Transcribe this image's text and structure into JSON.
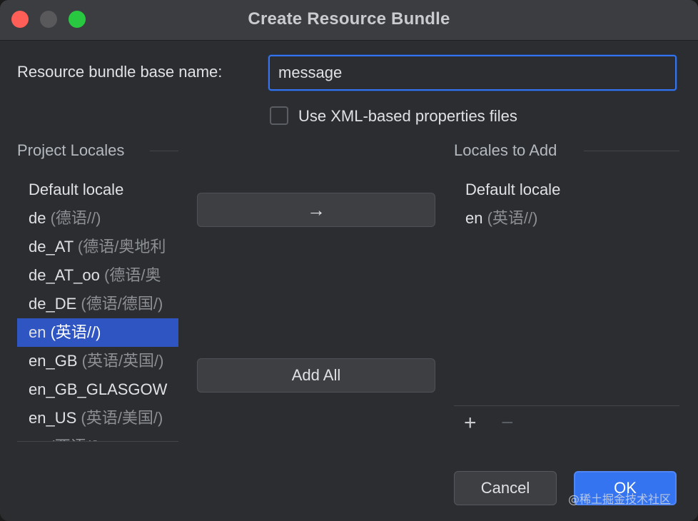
{
  "window": {
    "title": "Create Resource Bundle",
    "watermark": "@稀土掘金技术社区"
  },
  "form": {
    "basename_label": "Resource bundle base name:",
    "basename_value": "message",
    "xml_checkbox_label": "Use XML-based properties files",
    "xml_checked": false
  },
  "project_locales": {
    "title": "Project Locales",
    "items": [
      {
        "code": "Default locale",
        "desc": ""
      },
      {
        "code": "de",
        "desc": "(德语//)"
      },
      {
        "code": "de_AT",
        "desc": "(德语/奥地利"
      },
      {
        "code": "de_AT_oo",
        "desc": "(德语/奥"
      },
      {
        "code": "de_DE",
        "desc": "(德语/德国/)"
      },
      {
        "code": "en",
        "desc": "(英语//)"
      },
      {
        "code": "en_GB",
        "desc": "(英语/英国/)"
      },
      {
        "code": "en_GB_GLASGOW",
        "desc": ""
      },
      {
        "code": "en_US",
        "desc": "(英语/美国/)"
      },
      {
        "code": "es",
        "desc": "(西语//)"
      }
    ],
    "selected_index": 5
  },
  "actions": {
    "move_label": "→",
    "add_all_label": "Add All"
  },
  "locales_to_add": {
    "title": "Locales to Add",
    "items": [
      {
        "code": "Default locale",
        "desc": ""
      },
      {
        "code": "en",
        "desc": "(英语//)"
      }
    ],
    "add_icon": "+",
    "remove_icon": "−"
  },
  "buttons": {
    "cancel": "Cancel",
    "ok": "OK"
  },
  "colors": {
    "accent": "#3574f0",
    "selection": "#2e55c2",
    "background": "#2b2d30",
    "close": "#ff5f57",
    "maximize": "#28c840"
  }
}
